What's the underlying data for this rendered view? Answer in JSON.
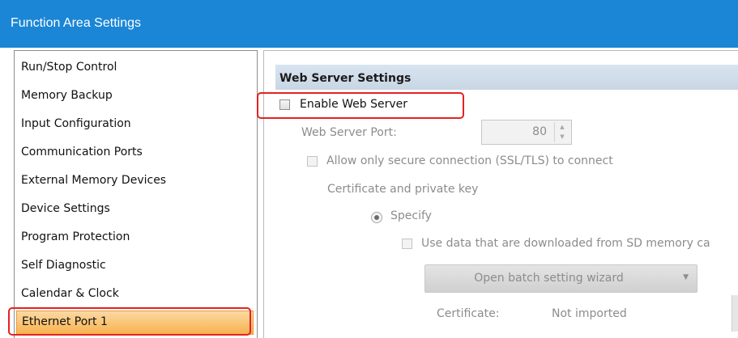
{
  "window": {
    "title": "Function Area Settings"
  },
  "nav": {
    "items": [
      {
        "label": "Run/Stop Control"
      },
      {
        "label": "Memory Backup"
      },
      {
        "label": "Input Configuration"
      },
      {
        "label": "Communication Ports"
      },
      {
        "label": "External Memory Devices"
      },
      {
        "label": "Device Settings"
      },
      {
        "label": "Program Protection"
      },
      {
        "label": "Self Diagnostic"
      },
      {
        "label": "Calendar & Clock"
      },
      {
        "label": "Ethernet Port 1",
        "selected": true
      }
    ]
  },
  "web_server": {
    "header": "Web Server Settings",
    "enable_label": "Enable Web Server",
    "enable_checked": false,
    "port_label": "Web Server Port:",
    "port_value": "80",
    "secure_label": "Allow only secure connection (SSL/TLS) to connect",
    "secure_checked": false,
    "cert_key_label": "Certificate and private key",
    "specify_label": "Specify",
    "specify_selected": true,
    "use_sd_label": "Use data that are downloaded from SD memory ca",
    "use_sd_checked": false,
    "wizard_button": "Open batch setting wizard",
    "certificate_label": "Certificate:",
    "certificate_value": "Not imported"
  },
  "colors": {
    "titlebar": "#1b86d6",
    "selection": "#f8b24e",
    "highlight_box": "#e52222",
    "section_header": "#c9d6e4"
  }
}
